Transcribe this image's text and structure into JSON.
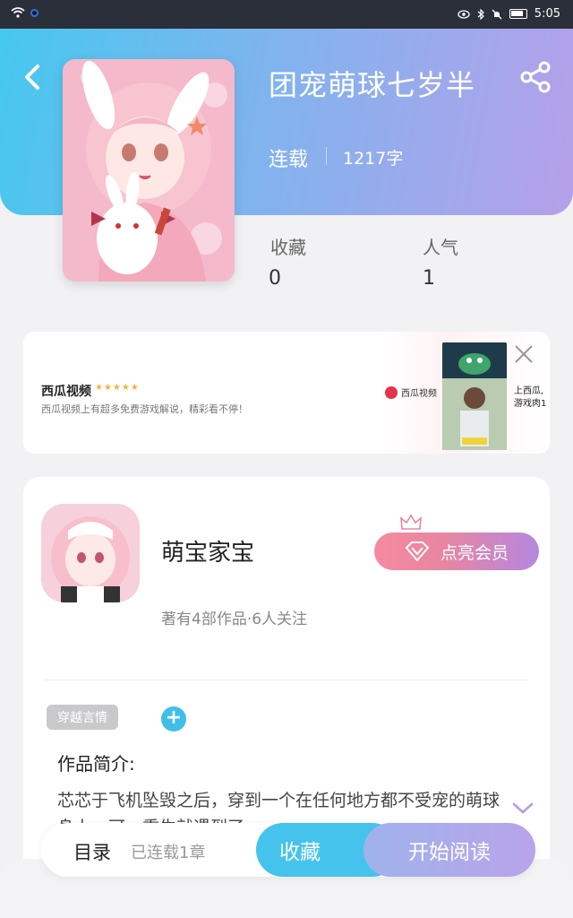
{
  "status_bar": {
    "time": "5:05"
  },
  "book": {
    "title": "团宠萌球七岁半",
    "status": "连载",
    "word_count": "1217字"
  },
  "stats": [
    {
      "label": "收藏",
      "value": "0"
    },
    {
      "label": "人气",
      "value": "1"
    }
  ],
  "ad": {
    "name": "西瓜视频",
    "stars": "★★★★★",
    "description": "西瓜视频上有超多免费游戏解说，精彩看不停！",
    "logo_text": "西瓜视频",
    "side_text_1": "上西瓜,",
    "side_text_2": "游戏肉1"
  },
  "author": {
    "name": "萌宝家宝",
    "meta": "著有4部作品·6人关注",
    "vip_label": "点亮会员"
  },
  "tags": [
    "穿越言情"
  ],
  "intro": {
    "title": "作品简介:",
    "text": "芯芯于飞机坠毁之后，穿到一个在任何地方都不受宠的萌球身上，可一重生就遇到了"
  },
  "bottom_bar": {
    "toc_label": "目录",
    "chapters_label": "已连载1章",
    "favorite_label": "收藏",
    "read_label": "开始阅读"
  }
}
